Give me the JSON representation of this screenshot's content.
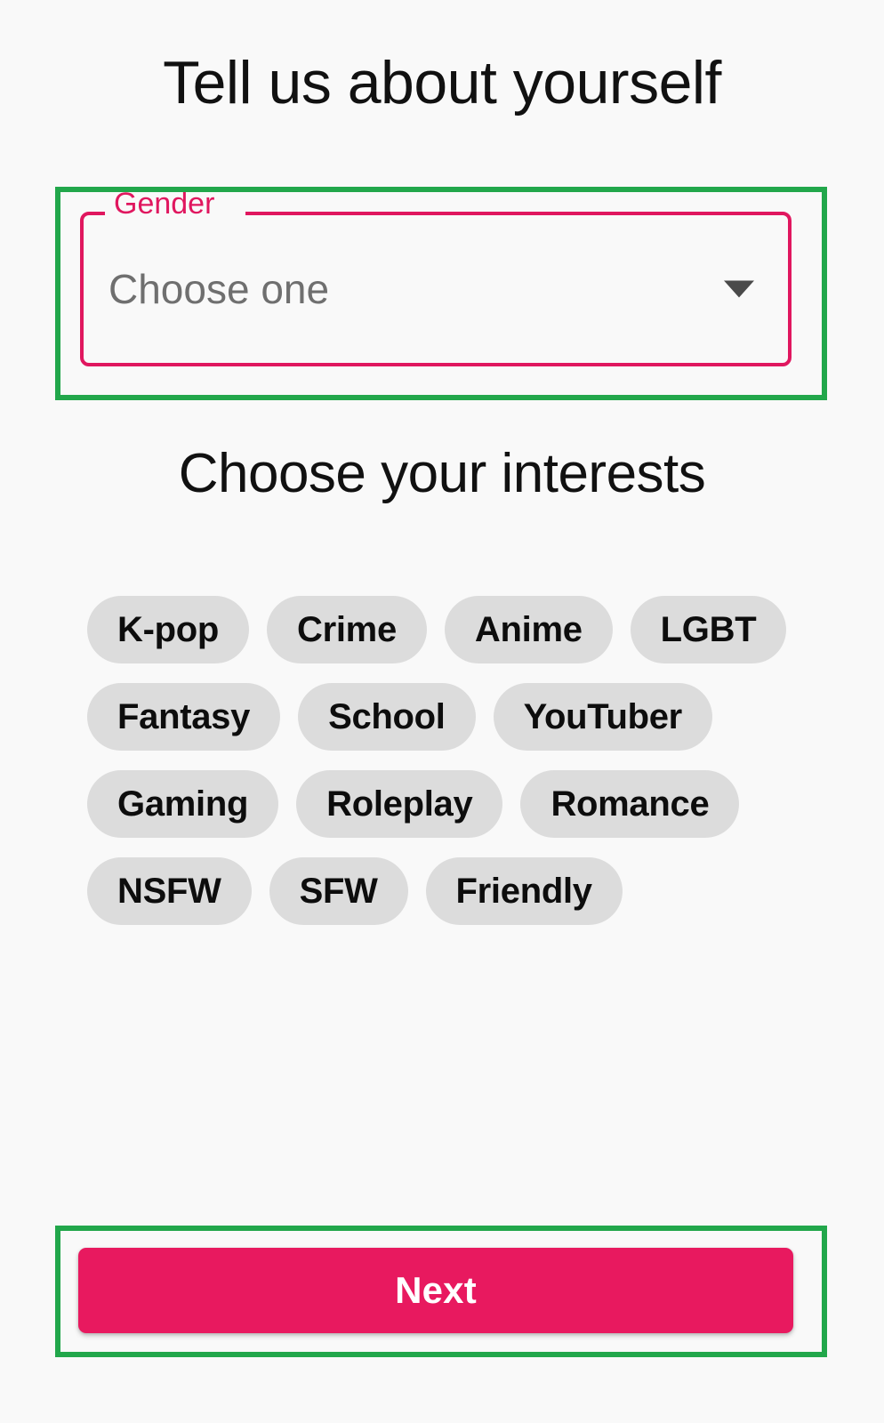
{
  "page": {
    "background_color": "#f9f9f9",
    "heading": "Tell us about yourself",
    "interests_heading": "Choose your interests"
  },
  "gender_field": {
    "label": "Gender",
    "value": "Choose one",
    "placeholder": "Choose one",
    "dropdown_icon": "chevron-down-icon",
    "border_color": "#e0175f",
    "label_color": "#e0175f",
    "value_color": "#6f6f6f"
  },
  "interests": {
    "chips": [
      {
        "label": "K-pop",
        "selected": false
      },
      {
        "label": "Crime",
        "selected": false
      },
      {
        "label": "Anime",
        "selected": false
      },
      {
        "label": "LGBT",
        "selected": false
      },
      {
        "label": "Fantasy",
        "selected": false
      },
      {
        "label": "School",
        "selected": false
      },
      {
        "label": "YouTuber",
        "selected": false
      },
      {
        "label": "Gaming",
        "selected": false
      },
      {
        "label": "Roleplay",
        "selected": false
      },
      {
        "label": "Romance",
        "selected": false
      },
      {
        "label": "NSFW",
        "selected": false
      },
      {
        "label": "SFW",
        "selected": false
      },
      {
        "label": "Friendly",
        "selected": false
      }
    ],
    "chip_background_color": "#dcdcdc",
    "chip_text_color": "#0d0d0d"
  },
  "primary_action": {
    "label": "Next",
    "background_color": "#e8195f",
    "text_color": "#ffffff"
  },
  "annotations": {
    "highlight_color": "#22a74b",
    "highlighted_targets": [
      "gender-select",
      "next-button"
    ]
  }
}
